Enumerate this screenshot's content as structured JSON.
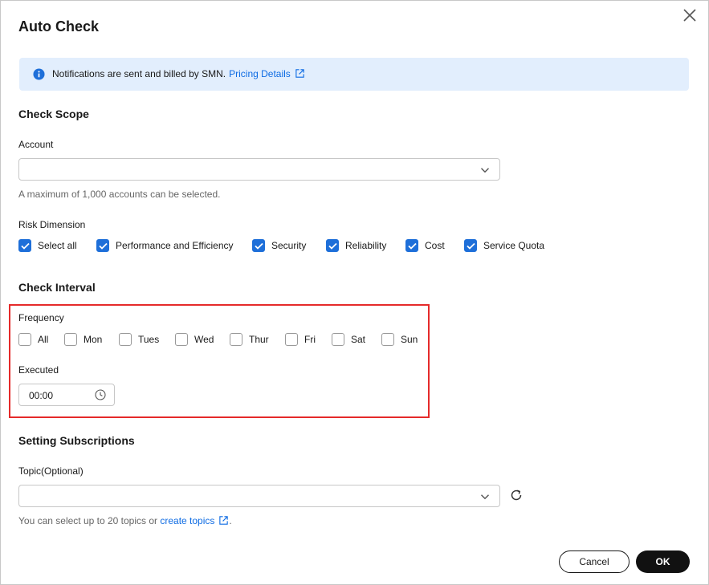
{
  "dialog": {
    "title": "Auto Check"
  },
  "notice": {
    "text": "Notifications are sent and billed by SMN.",
    "link": "Pricing Details"
  },
  "check_scope": {
    "title": "Check Scope",
    "account_label": "Account",
    "account_value": "",
    "account_hint": "A maximum of 1,000 accounts can be selected.",
    "risk_label": "Risk Dimension",
    "risk_options": [
      {
        "label": "Select all",
        "checked": true
      },
      {
        "label": "Performance and Efficiency",
        "checked": true
      },
      {
        "label": "Security",
        "checked": true
      },
      {
        "label": "Reliability",
        "checked": true
      },
      {
        "label": "Cost",
        "checked": true
      },
      {
        "label": "Service Quota",
        "checked": true
      }
    ]
  },
  "check_interval": {
    "title": "Check Interval",
    "frequency_label": "Frequency",
    "days": [
      {
        "label": "All",
        "checked": false
      },
      {
        "label": "Mon",
        "checked": false
      },
      {
        "label": "Tues",
        "checked": false
      },
      {
        "label": "Wed",
        "checked": false
      },
      {
        "label": "Thur",
        "checked": false
      },
      {
        "label": "Fri",
        "checked": false
      },
      {
        "label": "Sat",
        "checked": false
      },
      {
        "label": "Sun",
        "checked": false
      }
    ],
    "executed_label": "Executed",
    "executed_time": "00:00"
  },
  "subscriptions": {
    "title": "Setting Subscriptions",
    "topic_label": "Topic(Optional)",
    "topic_value": "",
    "hint_prefix": "You can select up to 20 topics or",
    "hint_link": "create topics",
    "hint_suffix": "."
  },
  "footer": {
    "cancel_label": "Cancel",
    "ok_label": "OK"
  },
  "colors": {
    "accent": "#1e6fd9",
    "link": "#0d6be3",
    "notice_bg": "#e2eefd",
    "highlight": "#e52a2a",
    "primary_button": "#111111"
  }
}
